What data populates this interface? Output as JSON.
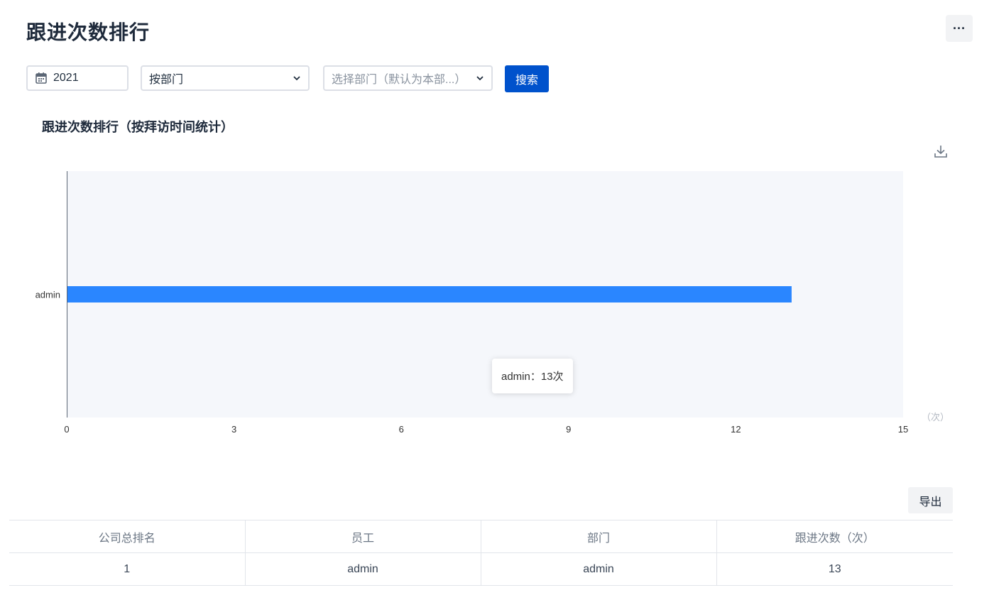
{
  "header": {
    "title": "跟进次数排行",
    "more_icon": "more-horizontal-icon",
    "more_label": "···"
  },
  "filters": {
    "year": "2021",
    "year_icon": "calendar-icon",
    "range_type": "按部门",
    "department_placeholder": "选择部门（默认为本部...）",
    "search_label": "搜索"
  },
  "chart_section": {
    "title": "跟进次数排行（按拜访时间统计）",
    "download_icon": "download-icon",
    "tooltip": "admin：13次"
  },
  "chart_data": {
    "type": "bar",
    "orientation": "horizontal",
    "categories": [
      "admin"
    ],
    "values": [
      13
    ],
    "xlim": [
      0,
      15
    ],
    "x_ticks": [
      "0",
      "3",
      "6",
      "9",
      "12",
      "15"
    ],
    "x_unit": "（次）",
    "bar_color": "#2a86ff",
    "plot_background": "#f5f7fb",
    "grid": false
  },
  "table": {
    "export_label": "导出",
    "columns": [
      "公司总排名",
      "员工",
      "部门",
      "跟进次数（次）"
    ],
    "rows": [
      [
        "1",
        "admin",
        "admin",
        "13"
      ]
    ]
  },
  "colors": {
    "primary": "#0052cc",
    "bar": "#2a86ff"
  }
}
